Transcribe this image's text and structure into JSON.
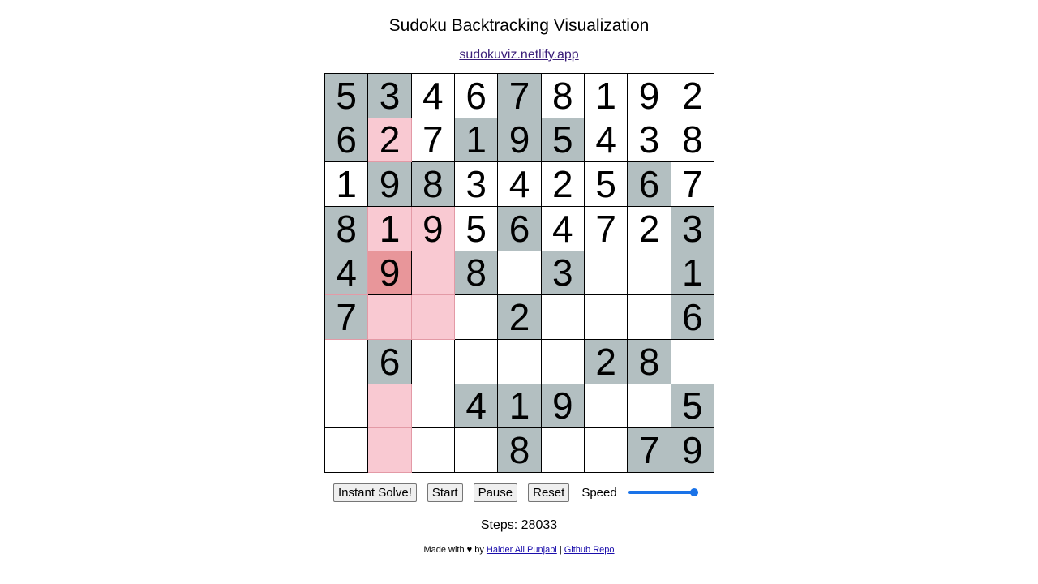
{
  "header": {
    "title": "Sudoku Backtracking Visualization",
    "site_link": "sudokuviz.netlify.app"
  },
  "board": {
    "rows": [
      [
        "5",
        "3",
        "4",
        "6",
        "7",
        "8",
        "1",
        "9",
        "2"
      ],
      [
        "6",
        "2",
        "7",
        "1",
        "9",
        "5",
        "4",
        "3",
        "8"
      ],
      [
        "1",
        "9",
        "8",
        "3",
        "4",
        "2",
        "5",
        "6",
        "7"
      ],
      [
        "8",
        "1",
        "9",
        "5",
        "6",
        "4",
        "7",
        "2",
        "3"
      ],
      [
        "4",
        "9",
        "",
        "8",
        "",
        "3",
        "",
        "",
        "1"
      ],
      [
        "7",
        "",
        "",
        "",
        "2",
        "",
        "",
        "",
        "6"
      ],
      [
        "",
        "6",
        "",
        "",
        "",
        "",
        "2",
        "8",
        ""
      ],
      [
        "",
        "",
        "",
        "4",
        "1",
        "9",
        "",
        "",
        "5"
      ],
      [
        "",
        "",
        "",
        "",
        "8",
        "",
        "",
        "7",
        "9"
      ]
    ],
    "state": [
      [
        "given",
        "given",
        "empty",
        "empty",
        "given",
        "empty",
        "empty",
        "empty",
        "empty"
      ],
      [
        "given",
        "mark",
        "empty",
        "given",
        "given",
        "given",
        "empty",
        "empty",
        "empty"
      ],
      [
        "empty",
        "given",
        "given",
        "empty",
        "empty",
        "empty",
        "empty",
        "given",
        "empty"
      ],
      [
        "mark-given",
        "mark",
        "mark",
        "empty",
        "given",
        "empty",
        "empty",
        "empty",
        "given"
      ],
      [
        "mark-given",
        "active",
        "mark",
        "given",
        "empty",
        "given",
        "empty",
        "empty",
        "given"
      ],
      [
        "mark-given",
        "mark",
        "mark",
        "empty",
        "given",
        "empty",
        "empty",
        "empty",
        "given"
      ],
      [
        "empty",
        "given",
        "empty",
        "empty",
        "empty",
        "empty",
        "given",
        "given",
        "empty"
      ],
      [
        "empty",
        "mark",
        "empty",
        "given",
        "given",
        "given",
        "empty",
        "empty",
        "given"
      ],
      [
        "empty",
        "mark",
        "empty",
        "empty",
        "given",
        "empty",
        "empty",
        "given",
        "given"
      ]
    ]
  },
  "controls": {
    "instant_solve_label": "Instant Solve!",
    "start_label": "Start",
    "pause_label": "Pause",
    "reset_label": "Reset",
    "speed_label": "Speed",
    "speed_value": 1.0
  },
  "status": {
    "steps_text": "Steps: 28033"
  },
  "footer": {
    "prefix": "Made with ♥ by ",
    "author_link": "Haider Ali Punjabi",
    "separator": " | ",
    "repo_link": "Github Repo"
  },
  "colors": {
    "given_cell": "#b3bfc1",
    "marked_cell": "#f9c9d2",
    "active_cell": "#e8969a",
    "slider": "#1a73e8"
  }
}
